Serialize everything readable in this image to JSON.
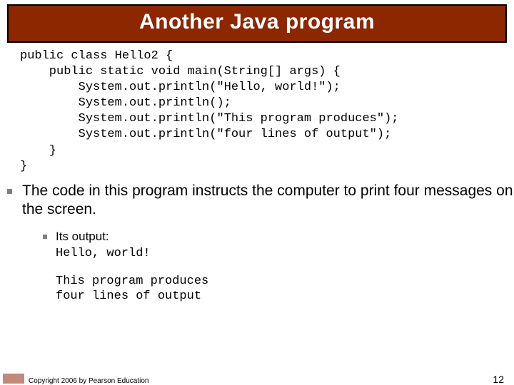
{
  "title": "Another Java program",
  "code": "public class Hello2 {\n    public static void main(String[] args) {\n        System.out.println(\"Hello, world!\");\n        System.out.println();\n        System.out.println(\"This program produces\");\n        System.out.println(\"four lines of output\");\n    }\n}",
  "bullet_main": "The code in this program instructs the computer to print four messages on the screen.",
  "sub_label": "Its output:",
  "sub_first_line": "Hello, world!",
  "output_rest": "This program produces\nfour lines of output",
  "copyright": "Copyright 2006 by Pearson Education",
  "page_number": "12"
}
